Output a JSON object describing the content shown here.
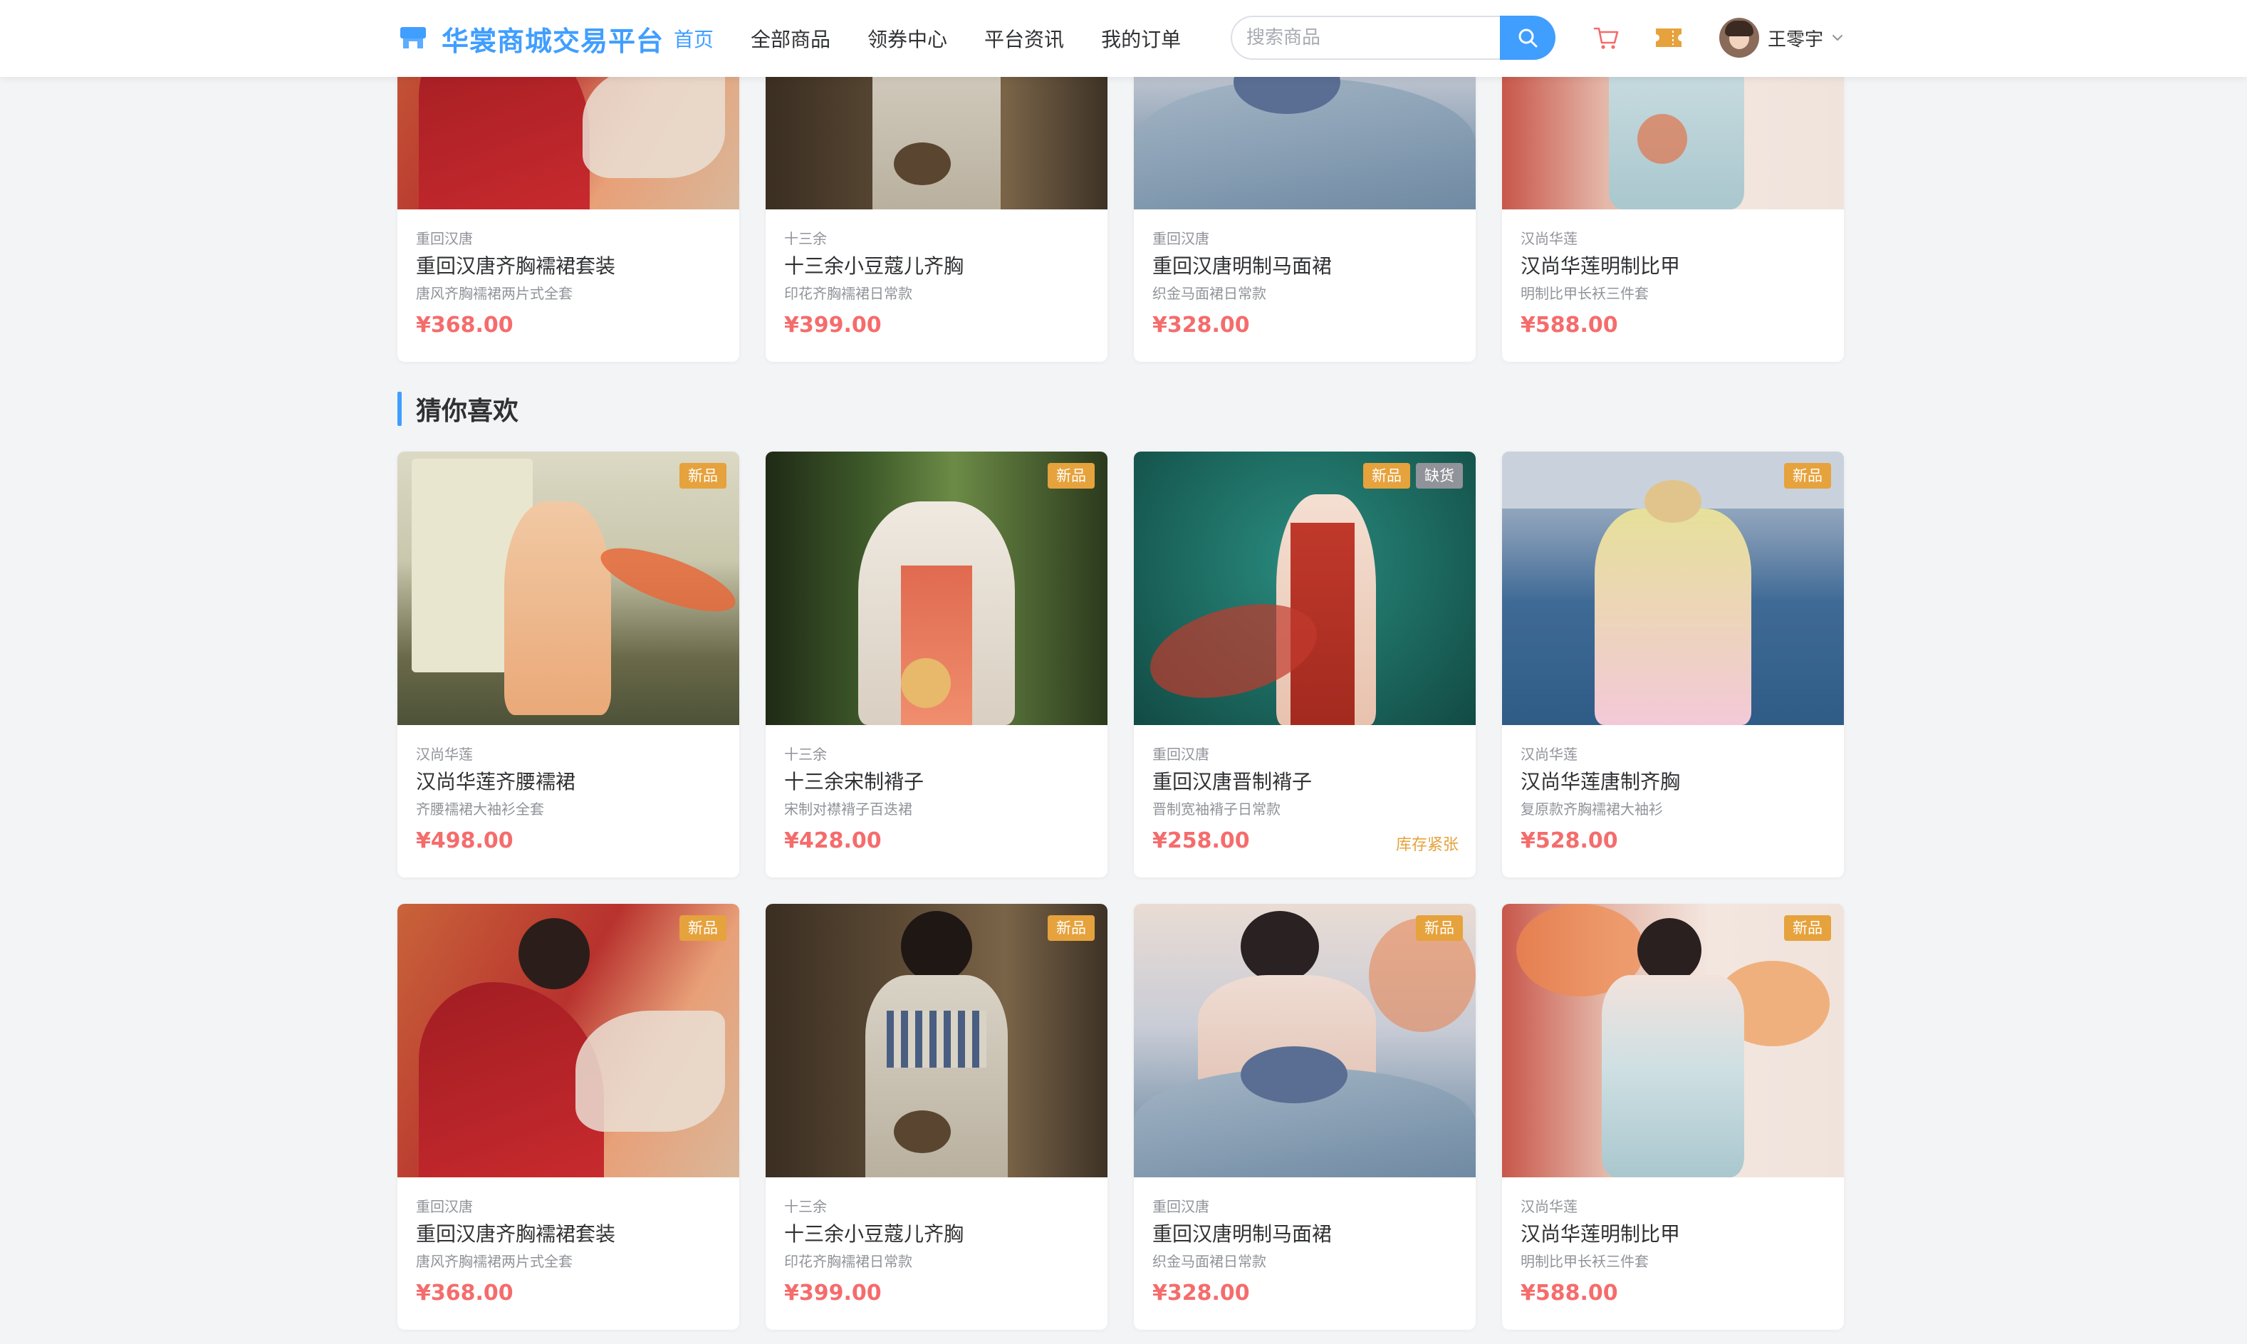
{
  "header": {
    "brand": "华裳商城交易平台",
    "nav": [
      "首页",
      "全部商品",
      "领券中心",
      "平台资讯",
      "我的订单"
    ],
    "search_placeholder": "搜索商品",
    "user_name": "王零宇"
  },
  "section_title": "猜你喜欢",
  "colors": {
    "accent": "#409eff",
    "price": "#f56c6c",
    "badge_new": "#e6a23c",
    "badge_oos": "#909399",
    "page_bg": "#f3f4f6"
  },
  "top_row": [
    {
      "shop": "重回汉唐",
      "name": "重回汉唐齐胸襦裙套装",
      "desc": "唐风齐胸襦裙两片式全套",
      "price": "¥368.00"
    },
    {
      "shop": "十三余",
      "name": "十三余小豆蔻儿齐胸",
      "desc": "印花齐胸襦裙日常款",
      "price": "¥399.00"
    },
    {
      "shop": "重回汉唐",
      "name": "重回汉唐明制马面裙",
      "desc": "织金马面裙日常款",
      "price": "¥328.00"
    },
    {
      "shop": "汉尚华莲",
      "name": "汉尚华莲明制比甲",
      "desc": "明制比甲长袄三件套",
      "price": "¥588.00"
    }
  ],
  "row2": [
    {
      "shop": "汉尚华莲",
      "name": "汉尚华莲齐腰襦裙",
      "desc": "齐腰襦裙大袖衫全套",
      "price": "¥498.00",
      "badges": [
        "新品"
      ]
    },
    {
      "shop": "十三余",
      "name": "十三余宋制褙子",
      "desc": "宋制对襟褙子百迭裙",
      "price": "¥428.00",
      "badges": [
        "新品"
      ]
    },
    {
      "shop": "重回汉唐",
      "name": "重回汉唐晋制褙子",
      "desc": "晋制宽袖褙子日常款",
      "price": "¥258.00",
      "badges": [
        "新品",
        "缺货"
      ],
      "stock_note": "库存紧张"
    },
    {
      "shop": "汉尚华莲",
      "name": "汉尚华莲唐制齐胸",
      "desc": "复原款齐胸襦裙大袖衫",
      "price": "¥528.00",
      "badges": [
        "新品"
      ]
    }
  ],
  "row3": [
    {
      "shop": "重回汉唐",
      "name": "重回汉唐齐胸襦裙套装",
      "desc": "唐风齐胸襦裙两片式全套",
      "price": "¥368.00",
      "badges": [
        "新品"
      ]
    },
    {
      "shop": "十三余",
      "name": "十三余小豆蔻儿齐胸",
      "desc": "印花齐胸襦裙日常款",
      "price": "¥399.00",
      "badges": [
        "新品"
      ]
    },
    {
      "shop": "重回汉唐",
      "name": "重回汉唐明制马面裙",
      "desc": "织金马面裙日常款",
      "price": "¥328.00",
      "badges": [
        "新品"
      ]
    },
    {
      "shop": "汉尚华莲",
      "name": "汉尚华莲明制比甲",
      "desc": "明制比甲长袄三件套",
      "price": "¥588.00",
      "badges": [
        "新品"
      ]
    }
  ]
}
